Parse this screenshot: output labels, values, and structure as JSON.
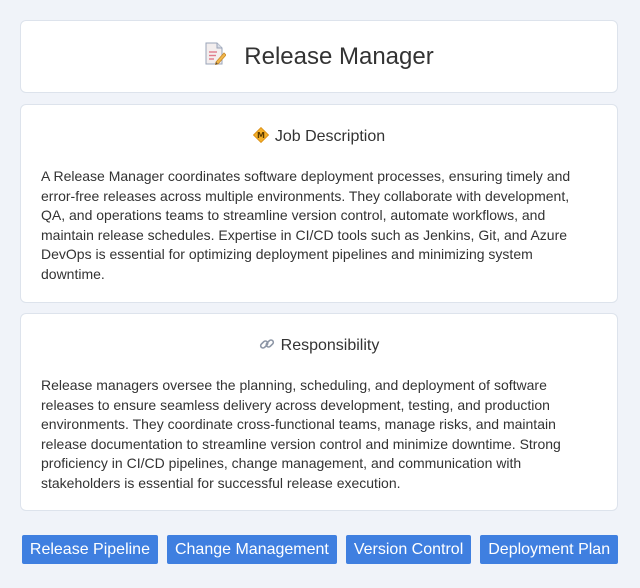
{
  "header": {
    "icon": "memo-icon",
    "title": "Release Manager"
  },
  "sections": [
    {
      "icon": "diamond-badge-icon",
      "title": "Job Description",
      "body": "A Release Manager coordinates software deployment processes, ensuring timely and error-free releases across multiple environments. They collaborate with development, QA, and operations teams to streamline version control, automate workflows, and maintain release schedules. Expertise in CI/CD tools such as Jenkins, Git, and Azure DevOps is essential for optimizing deployment pipelines and minimizing system downtime."
    },
    {
      "icon": "link-icon",
      "title": "Responsibility",
      "body": "Release managers oversee the planning, scheduling, and deployment of software releases to ensure seamless delivery across development, testing, and production environments. They coordinate cross-functional teams, manage risks, and maintain release documentation to streamline version control and minimize downtime. Strong proficiency in CI/CD pipelines, change management, and communication with stakeholders is essential for successful release execution."
    }
  ],
  "tags": [
    "Release Pipeline",
    "Change Management",
    "Version Control",
    "Deployment Plan"
  ],
  "colors": {
    "background": "#f0f3f9",
    "card": "#ffffff",
    "tag": "#3f7fe0"
  }
}
